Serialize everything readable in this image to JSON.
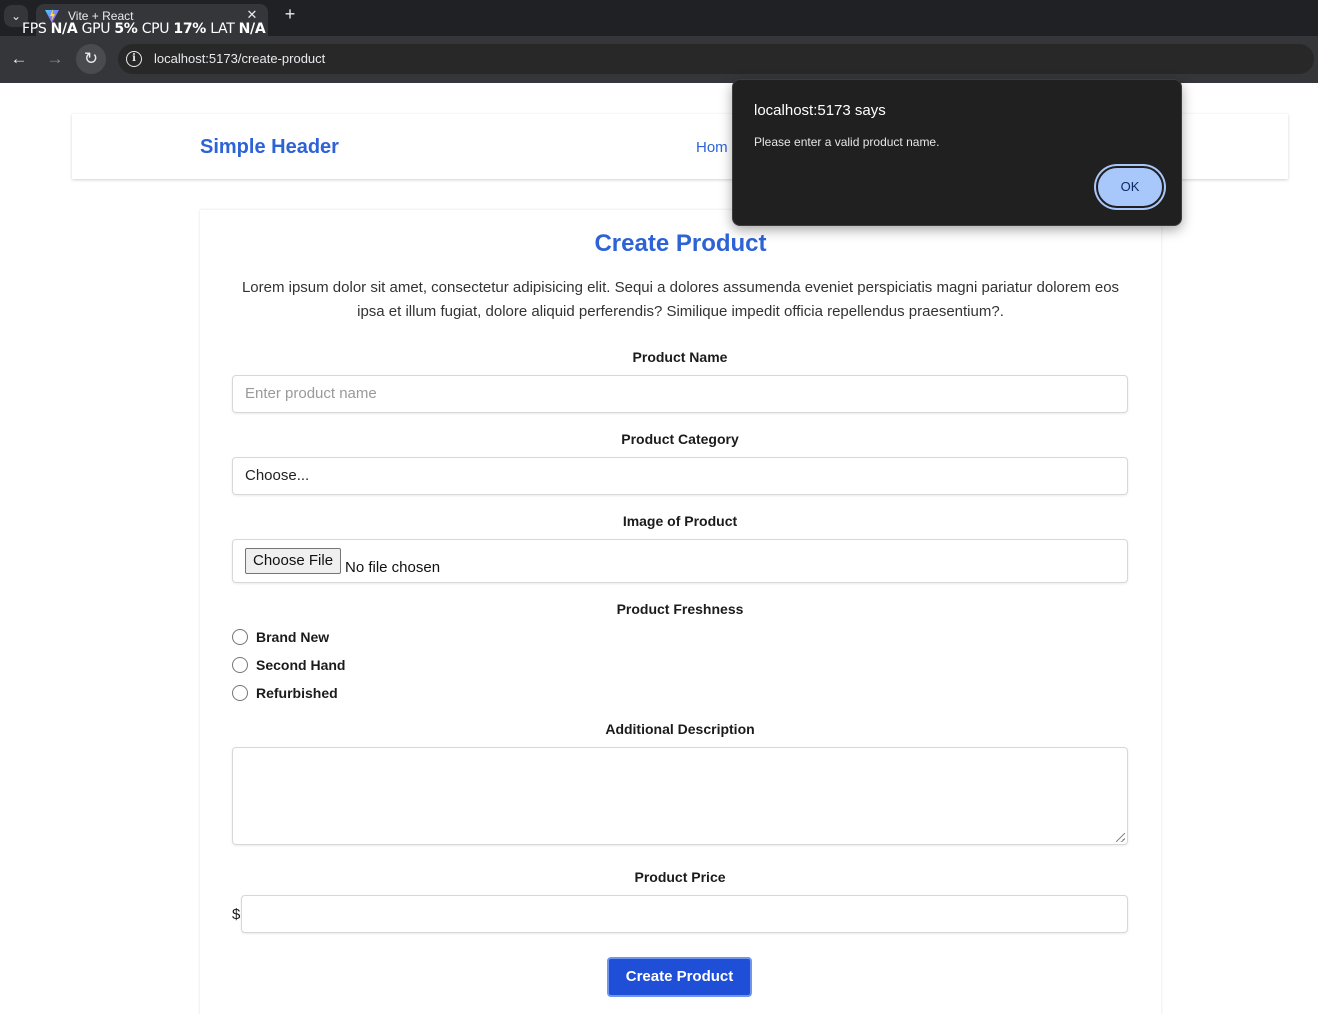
{
  "browser": {
    "tab_title": "Vite + React",
    "url": "localhost:5173/create-product",
    "perf": {
      "fps_label": "FPS",
      "fps_value": "N/A",
      "gpu_label": "GPU",
      "gpu_value": "5%",
      "cpu_label": "CPU",
      "cpu_value": "17%",
      "lat_label": "LAT",
      "lat_value": "N/A"
    },
    "tab_list_glyph": "⌄",
    "close_glyph": "✕",
    "new_tab_glyph": "+",
    "back_glyph": "←",
    "forward_glyph": "→",
    "reload_glyph": "↻",
    "info_glyph": "i"
  },
  "header": {
    "brand": "Simple Header",
    "nav_home": "Hom"
  },
  "form": {
    "title": "Create Product",
    "intro": "Lorem ipsum dolor sit amet, consectetur adipisicing elit. Sequi a dolores assumenda eveniet perspiciatis magni pariatur dolorem eos ipsa et illum fugiat, dolore aliquid perferendis? Similique impedit officia repellendus praesentium?.",
    "product_name": {
      "label": "Product Name",
      "placeholder": "Enter product name",
      "value": ""
    },
    "category": {
      "label": "Product Category",
      "selected": "Choose..."
    },
    "image": {
      "label": "Image of Product",
      "button": "Choose File",
      "status": "No file chosen"
    },
    "freshness": {
      "label": "Product Freshness",
      "options": [
        "Brand New",
        "Second Hand",
        "Refurbished"
      ],
      "selected": null
    },
    "description": {
      "label": "Additional Description",
      "value": ""
    },
    "price": {
      "label": "Product Price",
      "currency": "$",
      "value": ""
    },
    "submit": "Create Product"
  },
  "alert": {
    "title": "localhost:5173 says",
    "message": "Please enter a valid product name.",
    "ok": "OK"
  },
  "colors": {
    "accent": "#2d63d6",
    "button": "#1f4fd6",
    "alert_bg": "#202020",
    "alert_ok": "#a8c7fa"
  }
}
